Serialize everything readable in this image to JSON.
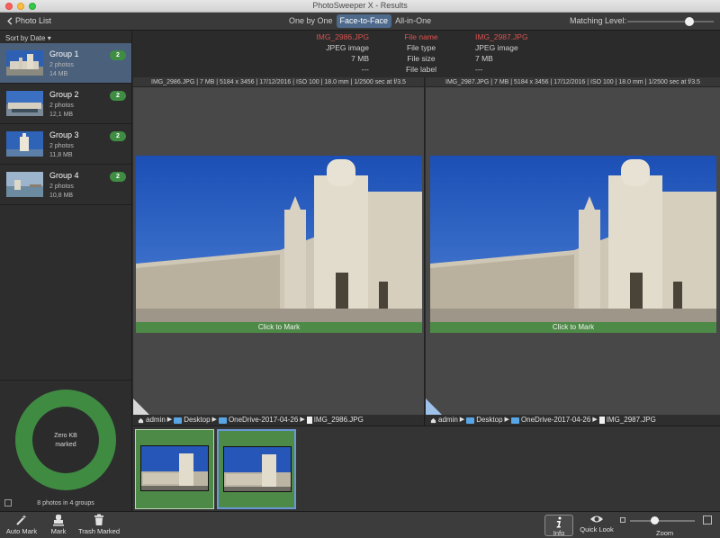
{
  "window": {
    "title": "PhotoSweeper X - Results"
  },
  "toolbar": {
    "back_label": "Photo List",
    "view_modes": [
      "One by One",
      "Face-to-Face",
      "All-in-One"
    ],
    "active_view": "Face-to-Face",
    "matching_level_label": "Matching Level:",
    "matching_level": 0.72
  },
  "sidebar": {
    "sort_label": "Sort by Date",
    "groups": [
      {
        "name": "Group 1",
        "photos": "2 photos",
        "size": "14 MB",
        "badge": "2",
        "selected": true
      },
      {
        "name": "Group 2",
        "photos": "2 photos",
        "size": "12,1 MB",
        "badge": "2",
        "selected": false
      },
      {
        "name": "Group 3",
        "photos": "2 photos",
        "size": "11,8 MB",
        "badge": "2",
        "selected": false
      },
      {
        "name": "Group 4",
        "photos": "2 photos",
        "size": "10,8 MB",
        "badge": "2",
        "selected": false
      }
    ],
    "donut_text_1": "Zero KB",
    "donut_text_2": "marked",
    "summary": "8 photos in 4 groups"
  },
  "info": {
    "labels": [
      "File name",
      "File type",
      "File size",
      "File label"
    ],
    "left": [
      "IMG_2986.JPG",
      "JPEG image",
      "7 MB",
      "---"
    ],
    "right": [
      "IMG_2987.JPG",
      "JPEG image",
      "7 MB",
      "---"
    ]
  },
  "left_pane": {
    "exif": "IMG_2986.JPG | 7 MB | 5184 x 3456 | 17/12/2016 | ISO 100 | 18.0 mm | 1/2500 sec at f/3.5",
    "mark_label": "Click to Mark",
    "path": [
      "admin",
      "Desktop",
      "OneDrive-2017-04-26",
      "IMG_2986.JPG"
    ]
  },
  "right_pane": {
    "exif": "IMG_2987.JPG | 7 MB | 5184 x 3456 | 17/12/2016 | ISO 100 | 18.0 mm | 1/2500 sec at f/3.5",
    "mark_label": "Click to Mark",
    "path": [
      "admin",
      "Desktop",
      "OneDrive-2017-04-26",
      "IMG_2987.JPG"
    ]
  },
  "bottom_bar": {
    "auto_mark": "Auto Mark",
    "mark": "Mark",
    "trash_marked": "Trash Marked",
    "info": "Info",
    "quick_look": "Quick Look",
    "zoom": "Zoom",
    "zoom_level": 0.38
  },
  "colors": {
    "accent": "#4e6a8c",
    "marked_green": "#4e8a47",
    "badge_green": "#3f8d43",
    "red_text": "#d9534f"
  },
  "icons": [
    "chevron-left-icon",
    "home-icon",
    "folder-icon",
    "document-icon",
    "magic-wand-icon",
    "stamp-icon",
    "trash-icon",
    "info-icon",
    "eye-icon"
  ]
}
